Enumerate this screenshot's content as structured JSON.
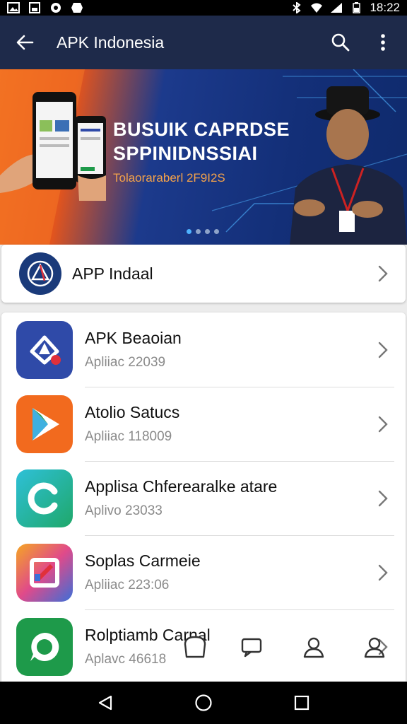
{
  "status_bar": {
    "time": "18:22"
  },
  "app_bar": {
    "title": "APK Indonesia"
  },
  "banner": {
    "headline_1": "BUSUIK CAPRDSE",
    "headline_2": "SPPINIDNSSIAI",
    "subtitle": "Tolaoraraberl 2F9I2S",
    "page_indicator": {
      "count": 4,
      "active": 1
    }
  },
  "featured": {
    "label": "APP Indaal"
  },
  "apps": [
    {
      "title": "APK Beaoian",
      "subtitle": "Apliiac 22039",
      "icon": "apk-beaoian-icon",
      "color": "#2f4aa8"
    },
    {
      "title": "Atolio Satucs",
      "subtitle": "Apliiac 118009",
      "icon": "play-triangle-icon",
      "color": "#f26a1e"
    },
    {
      "title": "Applisa Chferearalke atare",
      "subtitle": "Aplivo 23033",
      "icon": "c-logo-icon",
      "color": "#1fb0c8"
    },
    {
      "title": "Soplas Carmeie",
      "subtitle": "Apliiac 223:06",
      "icon": "camera-frame-icon",
      "color": "#e04a8a"
    },
    {
      "title": "Rolptiamb Carnal",
      "subtitle": "Aplavc 46618",
      "icon": "chat-bubble-icon",
      "color": "#1e9a4a"
    }
  ],
  "colors": {
    "app_bar": "#1e2a4a",
    "accent": "#f26a1e"
  }
}
